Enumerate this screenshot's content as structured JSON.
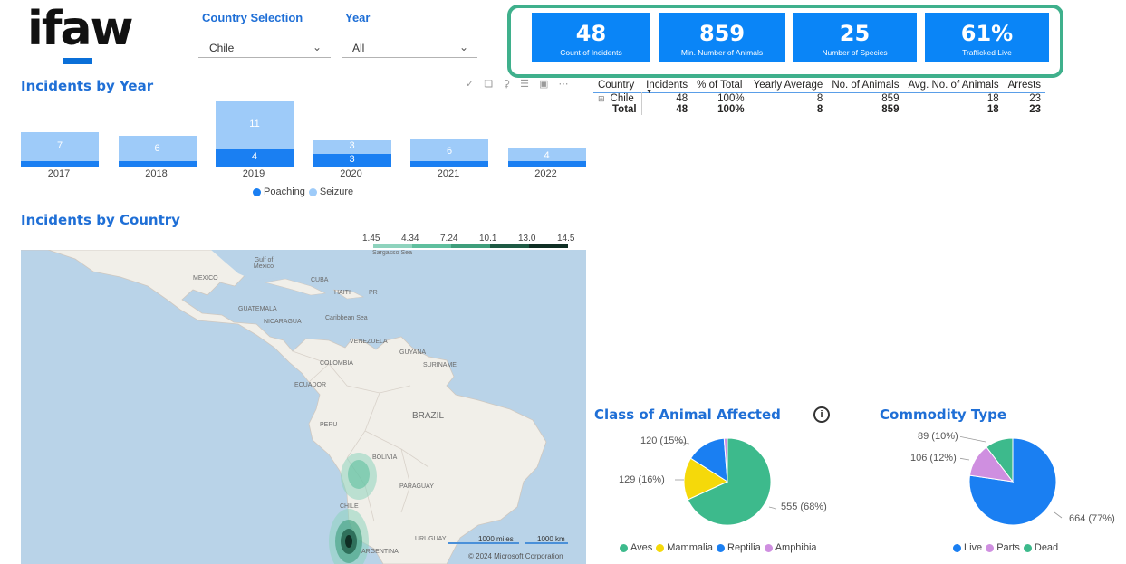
{
  "logo": {
    "text": "ifaw"
  },
  "slicers": {
    "country": {
      "title": "Country Selection",
      "value": "Chile"
    },
    "year": {
      "title": "Year",
      "value": "All"
    }
  },
  "kpis": [
    {
      "value": "48",
      "label": "Count of Incidents"
    },
    {
      "value": "859",
      "label": "Min. Number of Animals"
    },
    {
      "value": "25",
      "label": "Number of Species"
    },
    {
      "value": "61%",
      "label": "Trafficked Live"
    }
  ],
  "incidents_by_year": {
    "title": "Incidents by Year",
    "legend": [
      "Poaching",
      "Seizure"
    ]
  },
  "incidents_by_country": {
    "title": "Incidents by Country"
  },
  "heat_legend": [
    "1.45",
    "4.34",
    "7.24",
    "10.1",
    "13.0",
    "14.5"
  ],
  "map": {
    "labels": [
      "Gulf of Mexico",
      "Sargasso Sea",
      "MEXICO",
      "CUBA",
      "HAITI",
      "PR",
      "GUATEMALA",
      "NICARAGUA",
      "Caribbean Sea",
      "VENEZUELA",
      "GUYANA",
      "SURINAME",
      "COLOMBIA",
      "ECUADOR",
      "PERU",
      "BRAZIL",
      "BOLIVIA",
      "PARAGUAY",
      "CHILE",
      "URUGUAY",
      "ARGENTINA"
    ],
    "scale": [
      "1000 miles",
      "1000 km"
    ],
    "copyright": "© 2024 Microsoft Corporation"
  },
  "table": {
    "headers": [
      "Country",
      "Incidents",
      "% of Total",
      "Yearly Average",
      "No. of Animals",
      "Avg. No. of Animals",
      "Arrests"
    ],
    "rows": [
      {
        "expand": "⊞",
        "cells": [
          "Chile",
          "48",
          "100%",
          "8",
          "859",
          "18",
          "23"
        ]
      },
      {
        "cells": [
          "Total",
          "48",
          "100%",
          "8",
          "859",
          "18",
          "23"
        ]
      }
    ]
  },
  "class_chart": {
    "title": "Class of Animal Affected",
    "info_icon": "info-icon",
    "slice_labels": [
      "555 (68%)",
      "129 (16%)",
      "120 (15%)"
    ],
    "legend": [
      "Aves",
      "Mammalia",
      "Reptilia",
      "Amphibia"
    ]
  },
  "commodity_chart": {
    "title": "Commodity Type",
    "slice_labels": [
      "664 (77%)",
      "106 (12%)",
      "89 (10%)"
    ],
    "legend": [
      "Live",
      "Parts",
      "Dead"
    ]
  },
  "colors": {
    "accent": "#1f6fd6",
    "kpi": "#0a85f7",
    "kpi_border": "#3fb08c",
    "poaching": "#1a7ff2",
    "seizure": "#9ecbf9",
    "aves": "#3dba8c",
    "mammalia": "#f5d90a",
    "reptilia": "#1a7ff2",
    "amphibia": "#cf8fe0"
  },
  "chart_data": [
    {
      "type": "bar",
      "title": "Incidents by Year",
      "categories": [
        "2017",
        "2018",
        "2019",
        "2020",
        "2021",
        "2022"
      ],
      "series": [
        {
          "name": "Poaching",
          "values": [
            1,
            1,
            4,
            3,
            0.3,
            0.3
          ]
        },
        {
          "name": "Seizure",
          "values": [
            7,
            6,
            11,
            3,
            6,
            4
          ]
        }
      ],
      "stacked": true
    },
    {
      "type": "pie",
      "title": "Class of Animal Affected",
      "categories": [
        "Aves",
        "Mammalia",
        "Reptilia",
        "Amphibia"
      ],
      "values": [
        555,
        129,
        120,
        10
      ]
    },
    {
      "type": "pie",
      "title": "Commodity Type",
      "categories": [
        "Live",
        "Parts",
        "Dead"
      ],
      "values": [
        664,
        106,
        89
      ]
    }
  ]
}
